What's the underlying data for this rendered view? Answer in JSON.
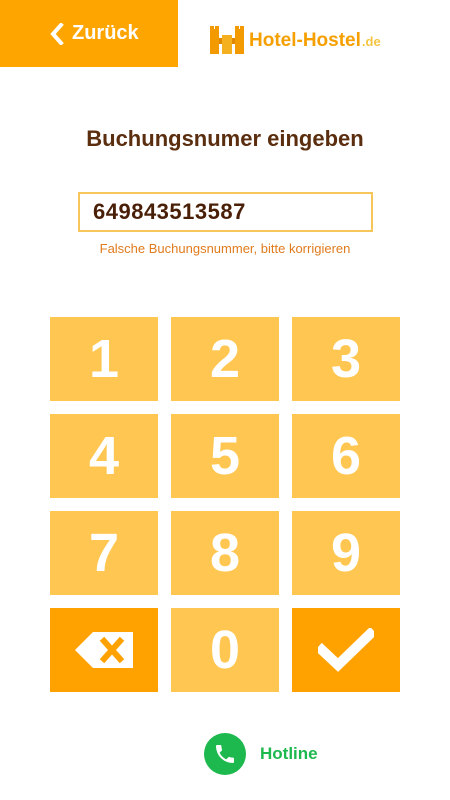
{
  "header": {
    "back_label": "Zurück",
    "brand_name": "Hotel-Hostel",
    "brand_tld": ".de"
  },
  "main": {
    "title": "Buchungsnumer eingeben",
    "booking_number_value": "649843513587",
    "error_message": "Falsche Buchungsnummer, bitte korrigieren"
  },
  "keypad": {
    "keys": [
      "1",
      "2",
      "3",
      "4",
      "5",
      "6",
      "7",
      "8",
      "9",
      "0"
    ],
    "backspace_icon": "backspace-icon",
    "confirm_icon": "checkmark-icon"
  },
  "footer": {
    "hotline_label": "Hotline",
    "hotline_icon": "phone-icon"
  },
  "colors": {
    "accent": "#FFA500",
    "key_light": "#FFC752",
    "key_dark": "#FFA200",
    "title": "#5A2E0E",
    "error": "#E07B1E",
    "hotline": "#1DB84E"
  }
}
